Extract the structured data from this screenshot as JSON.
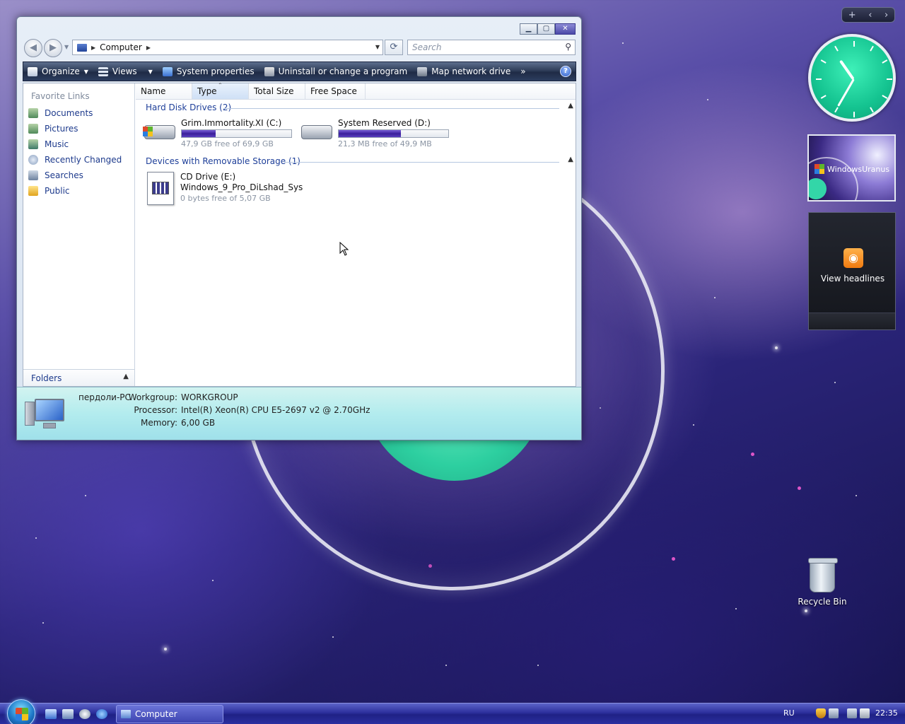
{
  "window": {
    "title_buttons": [
      "minimize",
      "maximize",
      "close"
    ],
    "address": {
      "crumb": "Computer"
    },
    "search": {
      "placeholder": "Search"
    },
    "toolbar": {
      "items": [
        {
          "label": "Organize",
          "icon": "organize-icon",
          "has_dropdown": true
        },
        {
          "label": "Views",
          "icon": "views-icon",
          "has_dropdown": true
        },
        {
          "label": "System properties",
          "icon": "system-properties-icon"
        },
        {
          "label": "Uninstall or change a program",
          "icon": "uninstall-icon"
        },
        {
          "label": "Map network drive",
          "icon": "map-network-drive-icon"
        }
      ],
      "more": "»"
    },
    "nav": {
      "favorites_header": "Favorite Links",
      "links": [
        "Documents",
        "Pictures",
        "Music",
        "Recently Changed",
        "Searches",
        "Public"
      ],
      "folders_label": "Folders"
    },
    "columns": [
      "Name",
      "Type",
      "Total Size",
      "Free Space"
    ],
    "groups": [
      {
        "title": "Hard Disk Drives (2)",
        "items": [
          {
            "name": "Grim.Immortality.XI (C:)",
            "subtitle": "47,9 GB free of 69,9 GB",
            "used_fraction": 0.31
          },
          {
            "name": "System Reserved (D:)",
            "subtitle": "21,3 MB free of 49,9 MB",
            "used_fraction": 0.57
          }
        ]
      },
      {
        "title": "Devices with Removable Storage (1)",
        "items": [
          {
            "name": "CD Drive (E:)",
            "label": "Windows_9_Pro_DiLshad_Sys",
            "subtitle": "0 bytes free of 5,07 GB"
          }
        ]
      }
    ],
    "details": {
      "computer_name": "пердоли-PC",
      "rows": [
        {
          "label": "Workgroup:",
          "value": "WORKGROUP"
        },
        {
          "label": "Processor:",
          "value": "Intel(R) Xeon(R) CPU E5-2697 v2 @ 2.70GHz"
        },
        {
          "label": "Memory:",
          "value": "6,00 GB"
        }
      ]
    }
  },
  "sidebar": {
    "controls": [
      "+",
      "‹",
      "›"
    ],
    "slideshow_text": "WindowsUranus",
    "feed_text": "View headlines"
  },
  "desktop": {
    "recycle_bin": "Recycle Bin"
  },
  "taskbar": {
    "task": "Computer",
    "language": "RU",
    "time": "22:35"
  },
  "colors": {
    "link_blue": "#1d3a8c",
    "group_blue": "#1e3f99",
    "drive_bar_fill": "#3a1f9a",
    "details_bg": "#b3ecee",
    "taskbar": "#2c2f9c",
    "clock_face": "#14c390"
  }
}
